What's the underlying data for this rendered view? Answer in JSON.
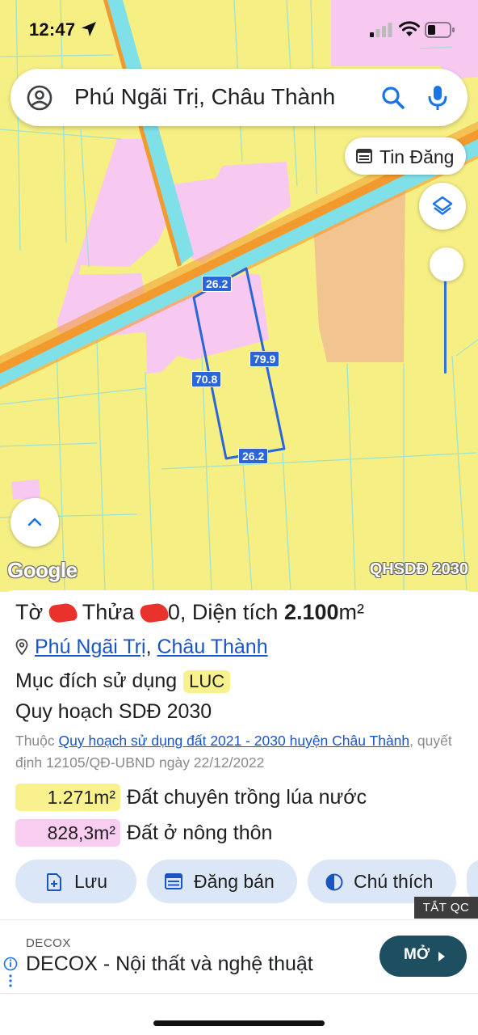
{
  "status_bar": {
    "time": "12:47",
    "icons": [
      "location-arrow-icon",
      "signal-icon",
      "wifi-icon",
      "battery-icon"
    ]
  },
  "search": {
    "query": "Phú Ngãi Trị, Châu Thành",
    "icons": [
      "account-icon",
      "search-icon",
      "microphone-icon"
    ]
  },
  "map": {
    "listing_button": "Tin Đăng",
    "dimensions": {
      "top": "26.2",
      "right": "79.9",
      "left": "70.8",
      "bottom": "26.2"
    },
    "google_logo": "Google",
    "layer_label": "QHSDĐ 2030",
    "colors": {
      "land_rice": "#f6ef84",
      "land_residential": "#f7c8f0",
      "land_other": "#f2c48f",
      "canal": "#7fe0e8",
      "road": "#f29a2e",
      "parcel_outline": "#2a66d8"
    }
  },
  "parcel": {
    "title_sheet_prefix": "Tờ",
    "title_sheet_number": "",
    "title_plot_prefix": "Thửa",
    "title_plot_suffix": "0",
    "title_area_label": ", Diện tích",
    "title_area_value": "2.100",
    "title_area_unit": "m²",
    "address_commune": "Phú Ngãi Trị",
    "address_separator": ",",
    "address_district": "Châu Thành",
    "purpose_label": "Mục đích sử dụng",
    "purpose_code": "LUC",
    "plan_title": "Quy hoạch SDĐ 2030",
    "belongs_prefix": "Thuộc",
    "belongs_link": "Quy hoạch sử dụng đất 2021 - 2030 huyện Châu Thành",
    "belongs_suffix": ", quyết định 12105/QĐ-UBND ngày 22/12/2022",
    "areas": [
      {
        "value": "1.271m²",
        "label": "Đất chuyên trồng lúa nước",
        "color": "#f8f18d"
      },
      {
        "value": "828,3m²",
        "label": "Đất ở nông thôn",
        "color": "#f8cdf0"
      }
    ]
  },
  "actions": {
    "save": "Lưu",
    "post_sale": "Đăng bán",
    "legend": "Chú thích"
  },
  "ad": {
    "hide_label": "TẮT QC",
    "source": "DECOX",
    "title": "DECOX - Nội thất và nghệ thuật",
    "cta": "MỞ"
  }
}
